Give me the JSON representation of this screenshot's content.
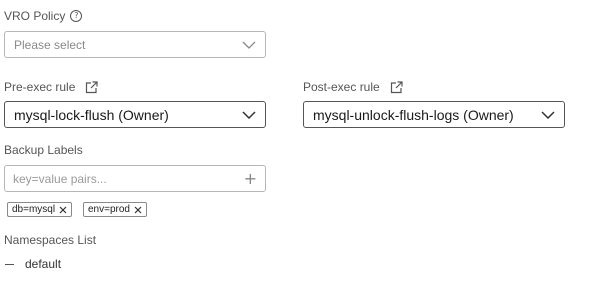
{
  "vro_policy": {
    "label": "VRO Policy",
    "placeholder": "Please select",
    "icon": "help-circle-icon"
  },
  "pre_exec": {
    "label": "Pre-exec rule",
    "value": "mysql-lock-flush (Owner)",
    "icon": "external-link-icon"
  },
  "post_exec": {
    "label": "Post-exec rule",
    "value": "mysql-unlock-flush-logs (Owner)",
    "icon": "external-link-icon"
  },
  "backup_labels": {
    "label": "Backup Labels",
    "placeholder": "key=value pairs...",
    "tags": [
      "db=mysql",
      "env=prod"
    ]
  },
  "namespaces": {
    "label": "Namespaces List",
    "items": [
      "default"
    ]
  }
}
